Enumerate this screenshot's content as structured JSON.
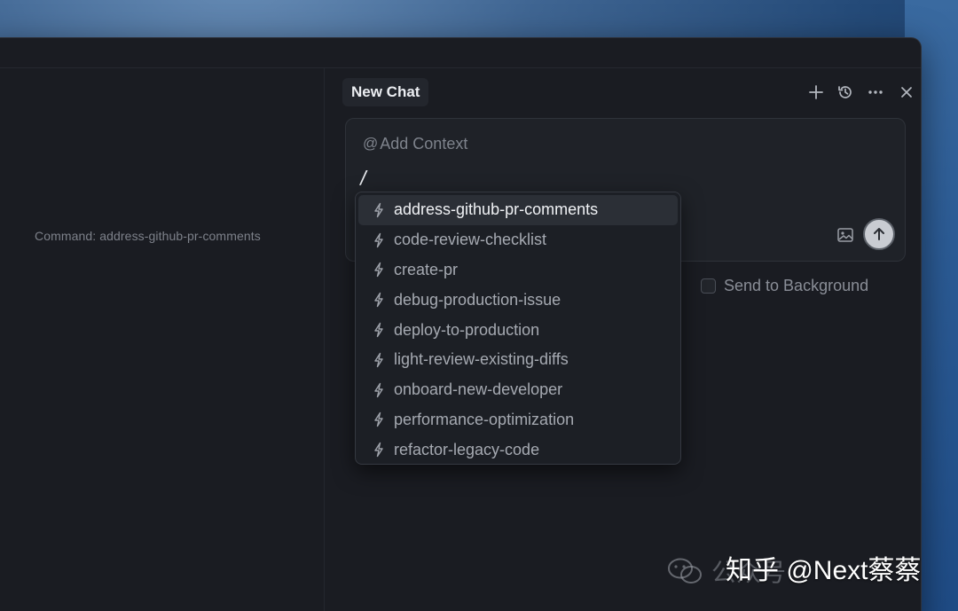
{
  "left_pane": {
    "command_label": "Command: address-github-pr-comments"
  },
  "chat": {
    "tab_title": "New Chat",
    "header_icons": [
      "plus-icon",
      "history-icon",
      "more-icon",
      "close-icon"
    ],
    "composer": {
      "add_context_label": "Add Context",
      "at_symbol": "@",
      "input_text": "/"
    },
    "send_to_background_label": "Send to Background"
  },
  "command_menu": {
    "items": [
      {
        "label": "address-github-pr-comments",
        "active": true
      },
      {
        "label": "code-review-checklist"
      },
      {
        "label": "create-pr"
      },
      {
        "label": "debug-production-issue"
      },
      {
        "label": "deploy-to-production"
      },
      {
        "label": "light-review-existing-diffs"
      },
      {
        "label": "onboard-new-developer"
      },
      {
        "label": "performance-optimization"
      },
      {
        "label": "refactor-legacy-code"
      }
    ]
  },
  "watermark": {
    "faded_text": "公众号",
    "text": "知乎 @Next蔡蔡"
  },
  "colors": {
    "window_bg": "#1a1c22",
    "active_item_bg": "#2b2f36",
    "text_primary": "#eceef2",
    "text_muted": "#a6aab2"
  }
}
